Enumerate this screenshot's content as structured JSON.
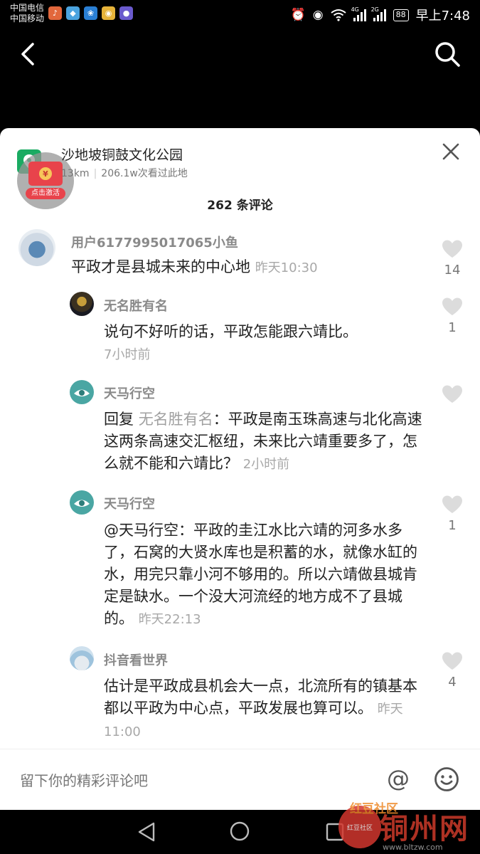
{
  "status_bar": {
    "carrier_1": "中国电信",
    "carrier_2": "中国移动",
    "network_1": "4G",
    "network_2": "2G",
    "battery": "88",
    "time": "早上7:48"
  },
  "location": {
    "title": "沙地坡铜鼓文化公园",
    "distance": "13km",
    "views": "206.1w次看过此地"
  },
  "red_packet": {
    "coin": "¥",
    "activate_label": "点击激活"
  },
  "comment_count": "262 条评论",
  "comments": [
    {
      "user": "用户6177995017065小鱼",
      "text": "平政才是县城未来的中心地",
      "time": "昨天10:30",
      "likes": "14"
    },
    {
      "user": "无名胜有名",
      "text": "说句不好听的话，平政怎能跟六靖比。",
      "time": "7小时前",
      "likes": "1"
    },
    {
      "user": "天马行空",
      "reply_prefix": "回复",
      "reply_to": "无名胜有名",
      "text": "：平政是南玉珠高速与北化高速这两条高速交汇枢纽，未来比六靖重要多了，怎么就不能和六靖比？",
      "time": "2小时前",
      "likes": ""
    },
    {
      "user": "天马行空",
      "text": "@天马行空：平政的圭江水比六靖的河多水多了，石窝的大贤水库也是积蓄的水，就像水缸的水，用完只靠小河不够用的。所以六靖做县城肯定是缺水。一个没大河流经的地方成不了县城的。",
      "time": "昨天22:13",
      "likes": "1"
    },
    {
      "user": "抖音看世界",
      "text": "估计是平政成县机会大一点，北流所有的镇基本都以平政为中心点，平政发展也算可以。",
      "time": "昨天11:00",
      "likes": "4"
    }
  ],
  "input": {
    "placeholder": "留下你的精彩评论吧",
    "at_symbol": "@"
  },
  "watermark": {
    "top": "红豆社区",
    "circle": "红豆社区",
    "main": "铜州网",
    "url": "www.bltzw.com"
  },
  "colors": {
    "sheet_bg": "#ffffff",
    "username": "#8a8a8a",
    "text": "#222222",
    "meta": "#a8a8a8",
    "heart": "#dddddd"
  }
}
